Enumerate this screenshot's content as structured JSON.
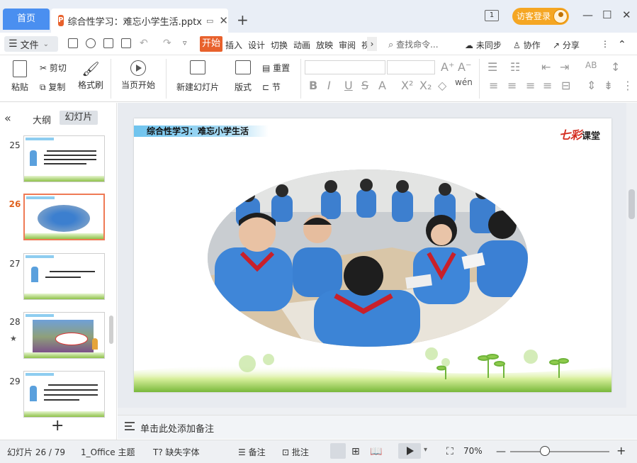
{
  "titlebar": {
    "home_tab": "首页",
    "doc_tab": "综合性学习：难忘小学生活.pptx",
    "ppt_badge": "P",
    "new_tab": "+",
    "window_count": "1",
    "login": "访客登录",
    "minimize": "—",
    "maximize": "☐",
    "close": "✕"
  },
  "menubar": {
    "file": "文件",
    "tabs": [
      "开始",
      "插入",
      "设计",
      "切换",
      "动画",
      "放映",
      "审阅",
      "视"
    ],
    "search": "查找命令...",
    "unsynced": "未同步",
    "collab": "协作",
    "share": "分享"
  },
  "ribbon": {
    "paste": "粘贴",
    "cut": "剪切",
    "copy": "复制",
    "format_painter": "格式刷",
    "from_start": "当页开始",
    "new_slide": "新建幻灯片",
    "layout": "版式",
    "reset": "重置",
    "section": "节",
    "font_size_inc": "A⁺",
    "font_size_dec": "A⁻"
  },
  "leftpanel": {
    "outline_tab": "大纲",
    "slides_tab": "幻灯片",
    "thumbnails": [
      {
        "num": "25",
        "active": false
      },
      {
        "num": "26",
        "active": true
      },
      {
        "num": "27",
        "active": false
      },
      {
        "num": "28",
        "active": false,
        "starred": "★"
      },
      {
        "num": "29",
        "active": false
      }
    ],
    "add": "+"
  },
  "slide": {
    "header_title": "综合性学习：难忘小学生活",
    "brand_red": "七彩",
    "brand_black": "课堂"
  },
  "notes": {
    "placeholder": "单击此处添加备注"
  },
  "statusbar": {
    "slide_counter": "幻灯片 26 / 79",
    "theme": "1_Office 主题",
    "missing_font": "缺失字体",
    "notes": "备注",
    "comments": "批注",
    "zoom": "70%",
    "zoom_level": 0.35
  },
  "colors": {
    "accent_blue": "#4a8ff0",
    "accent_orange": "#e8612c",
    "login_gold": "#f5a623"
  }
}
